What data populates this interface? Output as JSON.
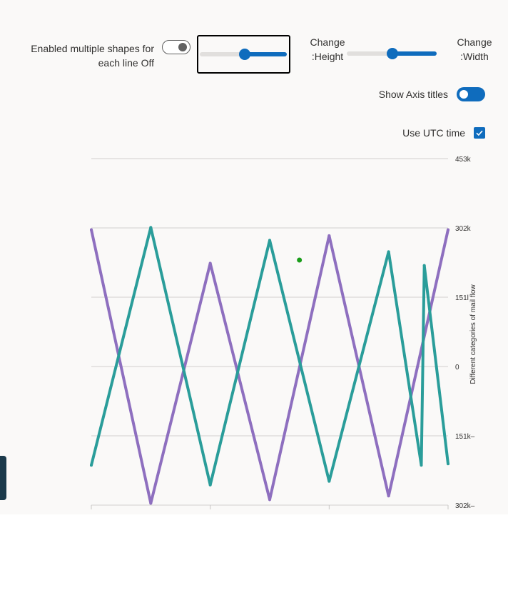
{
  "controls": {
    "multi_shape_label": "Enabled multiple shapes for each line Off",
    "multi_shape_line1": "Enabled multiple shapes for",
    "multi_shape_line2": "each line Off",
    "height_label_line1": "Change",
    "height_label_line2": ":Height",
    "width_label_line1": "Change",
    "width_label_line2": ":Width",
    "height_slider_value": 0.5,
    "width_slider_value": 0.5,
    "axis_titles_label": "Show Axis titles",
    "axis_titles_on": true,
    "utc_label": "Use UTC time",
    "utc_checked": true,
    "multi_shape_on": false
  },
  "colors": {
    "series1": "#8e6fbf",
    "series2": "#2a9d9a",
    "accent": "#0f6cbd",
    "point": "#1a9d1a"
  },
  "chart_data": {
    "type": "line",
    "ylabel": "Different categories of mail flow",
    "yticks": [
      "453k",
      "302k",
      "151l",
      "0",
      "151k–",
      "302k–"
    ],
    "ytick_values": [
      453000,
      302000,
      151000,
      0,
      -151000,
      -302000
    ],
    "ylim": [
      -302000,
      453000
    ],
    "xlim": [
      0,
      12
    ],
    "grid": true,
    "series": [
      {
        "x": [
          0,
          2,
          4,
          6,
          8,
          10,
          12
        ],
        "values": [
          298000,
          -298000,
          225000,
          -290000,
          285000,
          -282000,
          298000
        ]
      },
      {
        "x": [
          0,
          2,
          4,
          6,
          8,
          10,
          11.1,
          11.2,
          12
        ],
        "values": [
          -215000,
          303000,
          -258000,
          275000,
          -250000,
          250000,
          -215000,
          220000,
          -212000
        ]
      }
    ],
    "points": [
      {
        "x": 7,
        "values": 232000
      }
    ]
  }
}
